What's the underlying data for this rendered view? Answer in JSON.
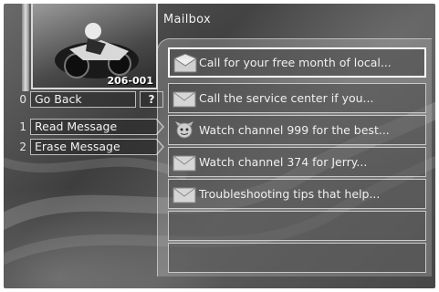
{
  "screen": {
    "title": "Mailbox",
    "channel_label": "206-001"
  },
  "menu": [
    {
      "number": "0",
      "label": "Go Back"
    },
    {
      "number": "1",
      "label": "Read Message"
    },
    {
      "number": "2",
      "label": "Erase Message"
    }
  ],
  "help_label": "?",
  "messages": [
    {
      "icon": "envelope-open-icon",
      "text": "Call for your free month of local...",
      "selected": true
    },
    {
      "icon": "envelope-icon",
      "text": "Call the service center if you..."
    },
    {
      "icon": "mascot-icon",
      "text": "Watch channel 999 for the best..."
    },
    {
      "icon": "envelope-icon",
      "text": "Watch channel 374 for Jerry..."
    },
    {
      "icon": "envelope-icon",
      "text": "Troubleshooting tips that help..."
    },
    {
      "text": ""
    },
    {
      "text": ""
    }
  ],
  "colors": {
    "panel_text": "#f0f0f0",
    "border": "#c9c9c9"
  }
}
